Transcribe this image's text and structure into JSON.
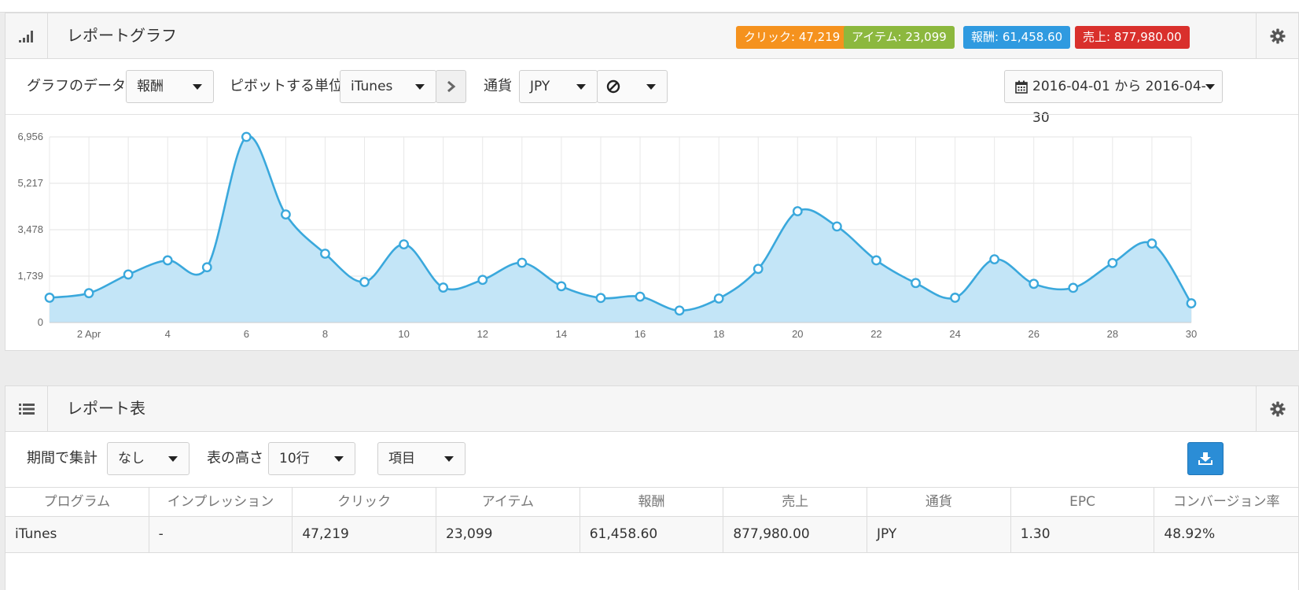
{
  "graph_panel": {
    "title": "レポートグラフ",
    "badges": [
      {
        "label": "クリック: 47,219",
        "color": "#f5921e"
      },
      {
        "label": "アイテム: 23,099",
        "color": "#8cb83e"
      },
      {
        "label": "報酬: 61,458.60",
        "color": "#2f9ae0"
      },
      {
        "label": "売上: 877,980.00",
        "color": "#d9302c"
      }
    ],
    "controls": {
      "graph_data_label": "グラフのデータ",
      "graph_data_value": "報酬",
      "pivot_label": "ピボットする単位",
      "pivot_value": "iTunes",
      "currency_label": "通貨",
      "currency_value": "JPY",
      "date_range": "2016-04-01 から 2016-04-30"
    },
    "icons": {
      "header": "signal-bars-icon",
      "gear": "gear-icon",
      "next": "chevron-right-icon",
      "ban": "ban-icon",
      "calendar": "calendar-icon"
    }
  },
  "chart_data": {
    "type": "area",
    "x": [
      1,
      2,
      3,
      4,
      5,
      6,
      7,
      8,
      9,
      10,
      11,
      12,
      13,
      14,
      15,
      16,
      17,
      18,
      19,
      20,
      21,
      22,
      23,
      24,
      25,
      26,
      27,
      28,
      29,
      30
    ],
    "x_tick_labels": [
      "2 Apr",
      "4",
      "6",
      "8",
      "10",
      "12",
      "14",
      "16",
      "18",
      "20",
      "22",
      "24",
      "26",
      "28",
      "30"
    ],
    "series": [
      {
        "values": [
          930,
          1100,
          1800,
          2330,
          2070,
          6956,
          4050,
          2580,
          1520,
          2930,
          1310,
          1600,
          2240,
          1360,
          920,
          970,
          450,
          900,
          2010,
          4170,
          3600,
          2330,
          1480,
          930,
          2370,
          1450,
          1300,
          2230,
          2960,
          720
        ]
      }
    ],
    "y_tick_labels": [
      "0",
      "1,739",
      "3,478",
      "5,217",
      "6,956"
    ],
    "ylim": [
      0,
      6956
    ],
    "grid": true,
    "color": "#3aa8dc",
    "fill": "#c3e5f7"
  },
  "table_panel": {
    "title": "レポート表",
    "controls": {
      "period_label": "期間で集計",
      "period_value": "なし",
      "height_label": "表の高さ",
      "height_value": "10行",
      "columns_value": "項目"
    },
    "icons": {
      "header": "list-icon",
      "gear": "gear-icon",
      "download": "download-icon"
    },
    "columns": [
      "プログラム",
      "インプレッション",
      "クリック",
      "アイテム",
      "報酬",
      "売上",
      "通貨",
      "EPC",
      "コンバージョン率"
    ],
    "rows": [
      [
        "iTunes",
        "-",
        "47,219",
        "23,099",
        "61,458.60",
        "877,980.00",
        "JPY",
        "1.30",
        "48.92%"
      ]
    ]
  }
}
